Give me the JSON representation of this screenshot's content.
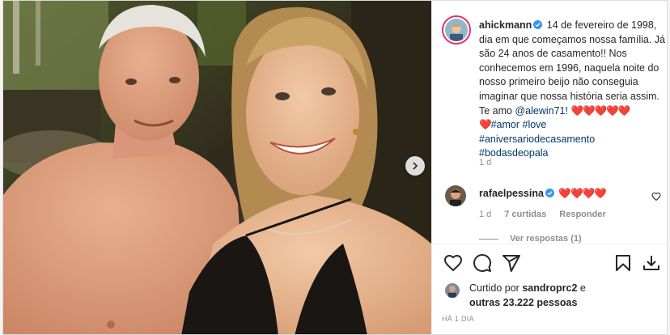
{
  "post": {
    "author": "ahickmann",
    "caption": {
      "text": " 14 de fevereiro de 1998, dia em que começamos nossa família. Já são 24 anos de casamento!! Nos conhecemos em 1996, naquela noite do nosso primeiro beijo não conseguia imaginar que nossa história seria assim. Te amo ",
      "mention": "@alewin71!",
      "hearts_inline": "❤️❤️❤️❤️❤️",
      "heart_lead": "❤️",
      "hashtags": [
        "#amor",
        "#love",
        "#aniversariodecasamento",
        "#bodasdeopala"
      ],
      "time": "1 d"
    },
    "comment": {
      "user": "rafaelpessina",
      "text": "❤️❤️❤️❤️",
      "time": "1 d",
      "likes": "7 curtidas",
      "reply": "Responder",
      "view_replies": "Ver respostas (1)"
    },
    "likes": {
      "prefix": "Curtido por",
      "user": "sandroprc2",
      "and": "e",
      "others": "outras 23.222 pessoas"
    },
    "timestamp": "HÁ 1 DIA"
  },
  "icons": {
    "next": "chevron-right-icon",
    "like": "heart-outline-icon",
    "comment": "comment-bubble-icon",
    "share": "paper-plane-icon",
    "save": "bookmark-icon",
    "download": "download-icon",
    "verified": "verified-badge-icon"
  },
  "colors": {
    "link": "#00376b",
    "verified": "#3897f0",
    "heart": "#ed4956",
    "muted": "#8e8e8e"
  }
}
